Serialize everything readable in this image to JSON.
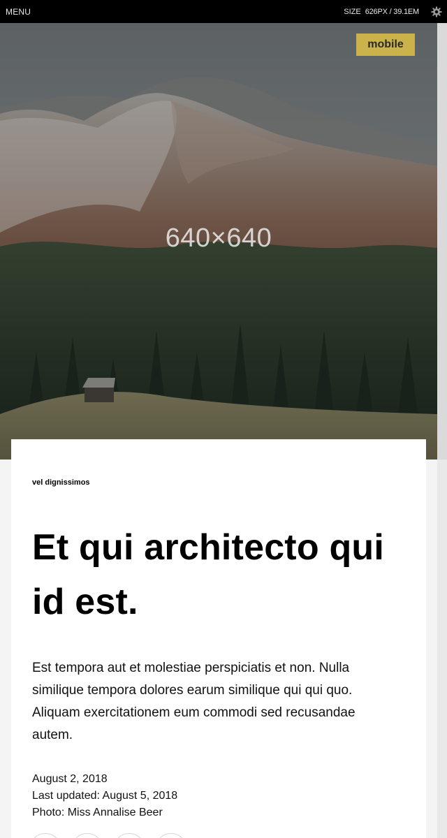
{
  "toolbar": {
    "menu_label": "MENU",
    "size_label": "SIZE",
    "size_value": "626PX / 39.1EM"
  },
  "hero": {
    "placeholder_text": "640×640",
    "badge_label": "mobile"
  },
  "article": {
    "kicker": "vel dignissimos",
    "headline": "Et qui architecto qui id est.",
    "dek": "Est tempora aut et molestiae perspiciatis et non. Nulla similique tempora dolores earum similique qui qui quo. Aliquam exercitationem eum commodi sed recusandae autem.",
    "date": "August 2, 2018",
    "updated": "Last updated: August 5, 2018",
    "photo_credit": "Photo: Miss Annalise Beer"
  },
  "colors": {
    "toolbar_bg": "#000000",
    "badge_bg": "#cbb24b",
    "page_bg": "#f4f4f4"
  },
  "icons": {
    "settings": "gear-icon"
  }
}
